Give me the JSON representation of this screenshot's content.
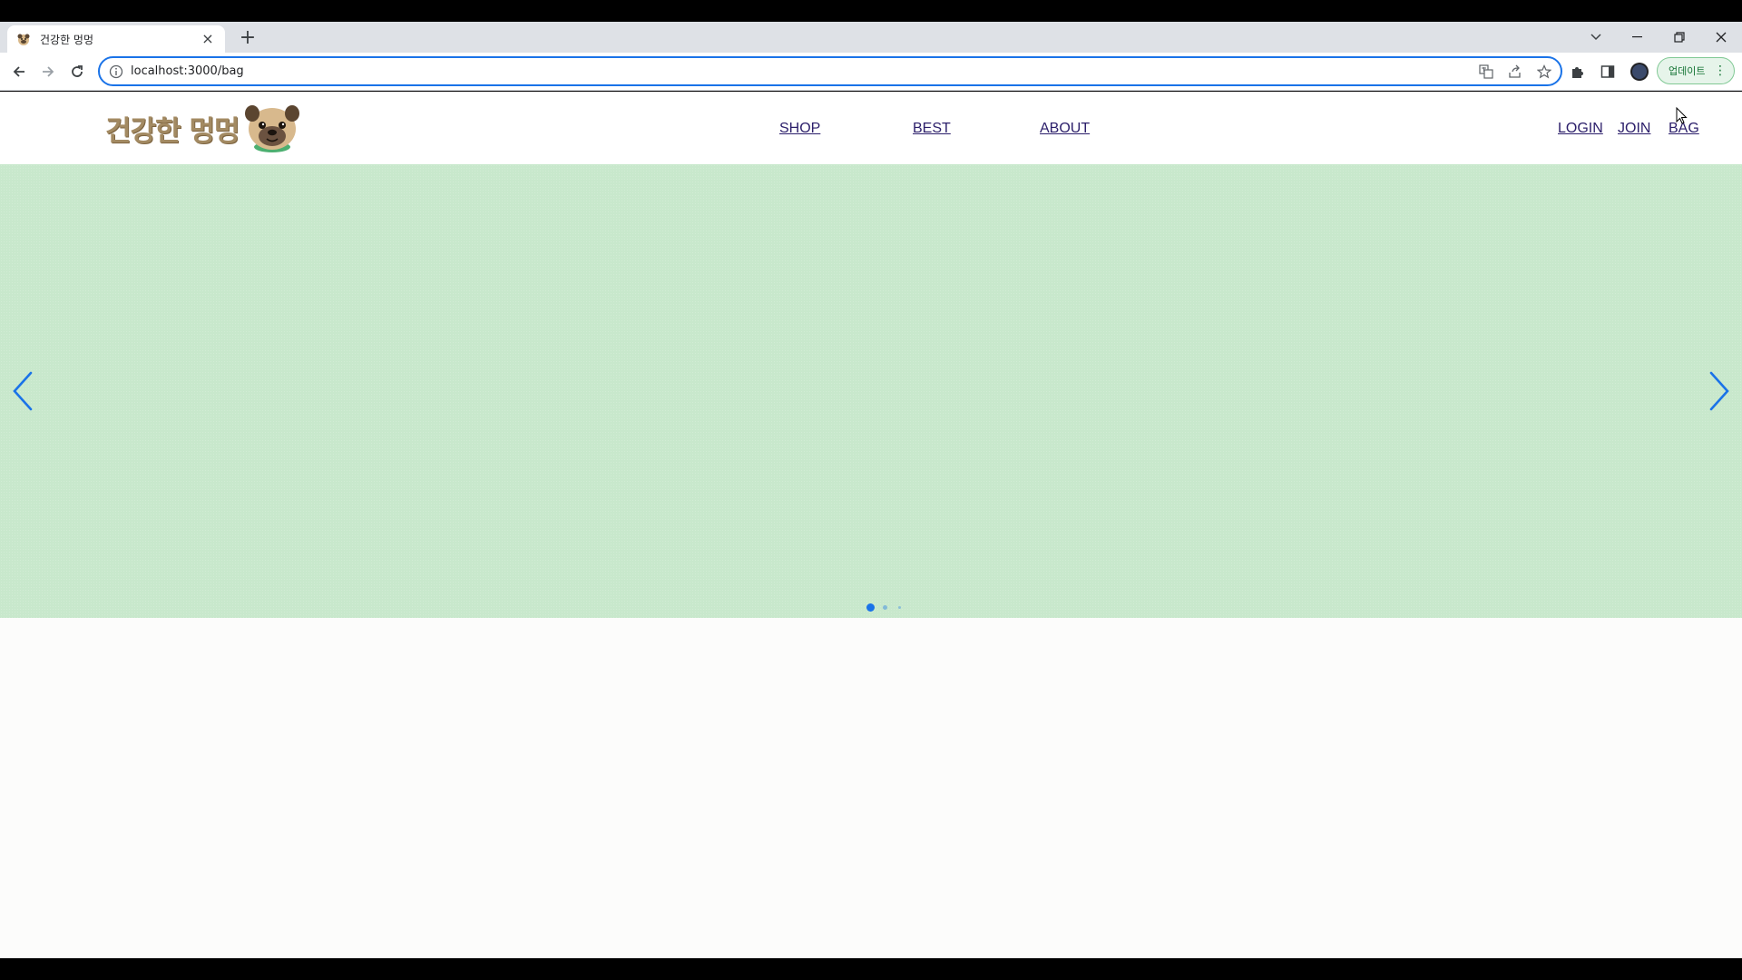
{
  "browser": {
    "tab_title": "건강한 멍멍",
    "tab_close": "×",
    "new_tab": "+",
    "url": "localhost:3000/bag",
    "update_label": "업데이트",
    "update_menu": "⋮"
  },
  "site": {
    "logo_text": "건강한 멍멍",
    "nav": [
      {
        "label": "SHOP"
      },
      {
        "label": "BEST"
      },
      {
        "label": "ABOUT"
      }
    ],
    "user_nav": [
      {
        "label": "LOGIN"
      },
      {
        "label": "JOIN"
      },
      {
        "label": "BAG"
      }
    ]
  },
  "slider": {
    "background": "#c8e8cc",
    "accent": "#1a73e8",
    "slide_count": 3,
    "active_index": 0
  },
  "icons": {
    "back": "arrow-left-icon",
    "forward": "arrow-right-icon",
    "reload": "reload-icon",
    "info": "info-icon",
    "translate": "translate-icon",
    "share": "share-icon",
    "star": "star-icon",
    "extensions": "puzzle-icon",
    "sidepanel": "side-panel-icon",
    "profile": "profile-avatar"
  }
}
